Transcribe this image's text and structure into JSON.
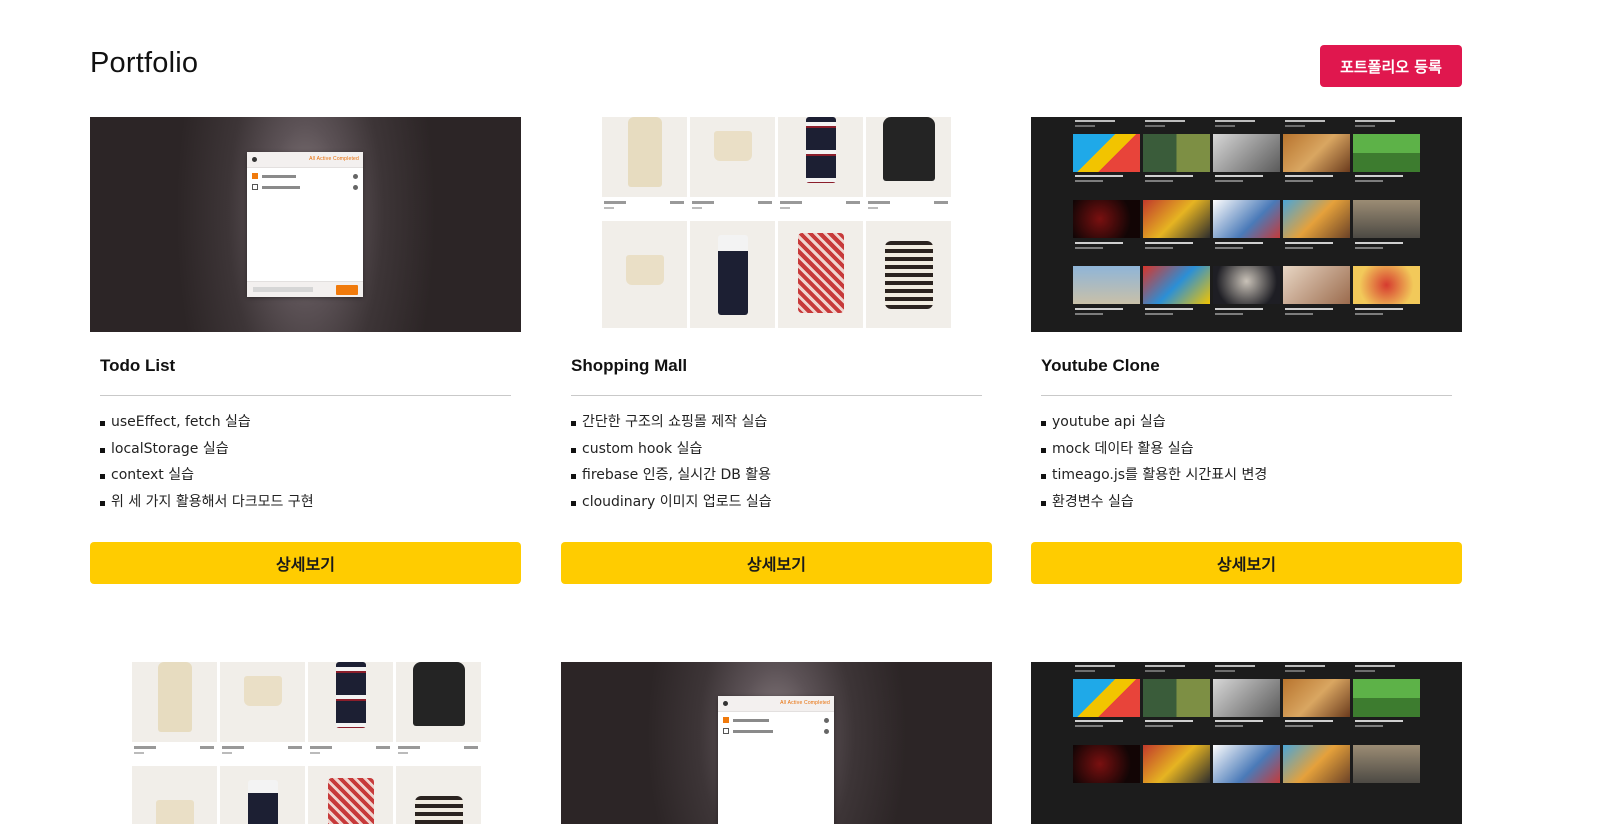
{
  "header": {
    "title": "Portfolio",
    "register_button": "포트폴리오 등록"
  },
  "colors": {
    "register_button_bg": "#e0174e",
    "detail_button_bg": "#ffcc00"
  },
  "cards": [
    {
      "title": "Todo List",
      "thumbnail": "todo-app-screenshot",
      "features": [
        "useEffect, fetch 실습",
        "localStorage 실습",
        "context 실습",
        "위 세 가지 활용해서 다크모드 구현"
      ],
      "button": "상세보기"
    },
    {
      "title": "Shopping Mall",
      "thumbnail": "shopping-mall-screenshot",
      "features": [
        "간단한 구조의 쇼핑몰 제작 실습",
        "custom hook 실습",
        "firebase 인증, 실시간 DB 활용",
        "cloudinary 이미지 업로드 실습"
      ],
      "button": "상세보기"
    },
    {
      "title": "Youtube Clone",
      "thumbnail": "youtube-clone-screenshot",
      "features": [
        "youtube api 실습",
        "mock 데이타 활용 실습",
        "timeago.js를 활용한 시간표시 변경",
        "환경변수 실습"
      ],
      "button": "상세보기"
    }
  ],
  "thumb_text": {
    "todo_tabs": "All  Active  Completed",
    "todo_add": "Add"
  }
}
